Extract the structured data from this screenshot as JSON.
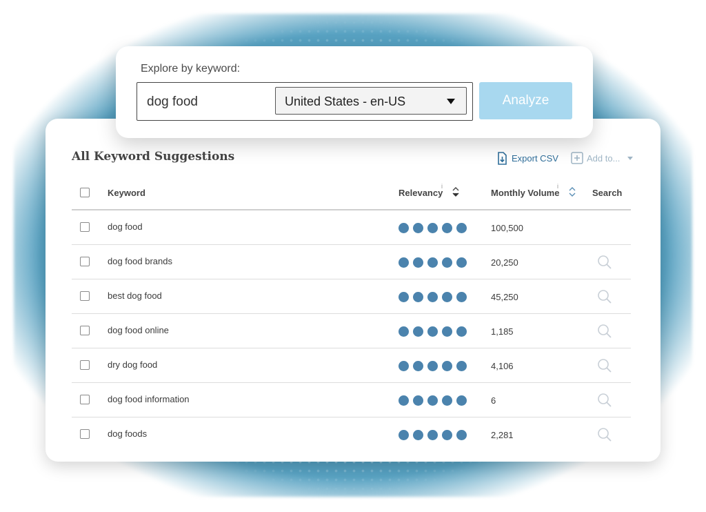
{
  "search": {
    "label": "Explore by keyword:",
    "keyword_value": "dog food",
    "locale_selected": "United States - en-US",
    "analyze_label": "Analyze"
  },
  "results": {
    "title": "All Keyword Suggestions",
    "export_label": "Export CSV",
    "add_to_label": "Add to...",
    "columns": {
      "keyword": "Keyword",
      "relevancy": "Relevancy",
      "relevancy_info": "i",
      "monthly_volume": "Monthly Volume",
      "monthly_volume_info": "i",
      "search": "Search"
    },
    "rows": [
      {
        "keyword": "dog food",
        "relevancy": 5,
        "volume": "100,500",
        "search_icon": false
      },
      {
        "keyword": "dog food brands",
        "relevancy": 5,
        "volume": "20,250",
        "search_icon": true
      },
      {
        "keyword": "best dog food",
        "relevancy": 5,
        "volume": "45,250",
        "search_icon": true
      },
      {
        "keyword": "dog food online",
        "relevancy": 5,
        "volume": "1,185",
        "search_icon": true
      },
      {
        "keyword": "dry dog food",
        "relevancy": 5,
        "volume": "4,106",
        "search_icon": true
      },
      {
        "keyword": "dog food information",
        "relevancy": 5,
        "volume": "6",
        "search_icon": true
      },
      {
        "keyword": "dog foods",
        "relevancy": 5,
        "volume": "2,281",
        "search_icon": true
      }
    ]
  },
  "colors": {
    "accent": "#2f6e9a",
    "relevancy_dot": "#4b83ad",
    "analyze_bg": "#a8d8ef",
    "backdrop": "#3b86ab"
  },
  "icons": {
    "dropdown": "caret-down-icon",
    "export": "export-csv-icon",
    "add": "plus-box-icon",
    "sort": "sort-icon",
    "search": "magnifier-icon"
  }
}
